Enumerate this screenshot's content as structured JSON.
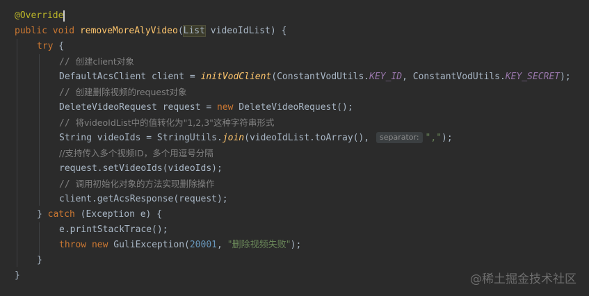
{
  "code": {
    "l1": {
      "annotation": "@Override"
    },
    "l2": {
      "kw1": "public",
      "kw2": "void",
      "method": "removeMoreAlyVideo",
      "open": "(",
      "type": "List",
      "rest": " videoIdList) {"
    },
    "l3": {
      "kw": "try",
      "rest": " {"
    },
    "l4": {
      "prefix": "// ",
      "text": "创建client对象"
    },
    "l5": {
      "a": "DefaultAcsClient client = ",
      "fn": "initVodClient",
      "b": "(ConstantVodUtils.",
      "c1": "KEY_ID",
      "c": ", ConstantVodUtils.",
      "c2": "KEY_SECRET",
      "d": ");"
    },
    "l6": {
      "prefix": "// ",
      "text": "创建删除视频的request对象"
    },
    "l7": {
      "a": "DeleteVideoRequest request = ",
      "kw": "new",
      "b": " DeleteVideoRequest();"
    },
    "l8": {
      "prefix": "// ",
      "text": "将videoIdList中的值转化为\"1,2,3\"这种字符串形式"
    },
    "l9": {
      "a": "String videoIds = StringUtils.",
      "fn": "join",
      "b": "(videoIdList.toArray(),",
      "hint": "separator:",
      "str": "\",\"",
      "d": ");"
    },
    "l10": {
      "text": "//支持传入多个视频ID，多个用逗号分隔"
    },
    "l11": {
      "code": "request.setVideoIds(videoIds);"
    },
    "l12": {
      "prefix": "// ",
      "text": "调用初始化对象的方法实现删除操作"
    },
    "l13": {
      "code": "client.getAcsResponse(request);"
    },
    "l14": {
      "a": "} ",
      "kw": "catch",
      "b": " (Exception e) {"
    },
    "l15": {
      "code": "e.printStackTrace();"
    },
    "l16": {
      "kw1": "throw",
      "kw2": "new",
      "a": " GuliException(",
      "num": "20001",
      "b": ", ",
      "str": "\"删除视频失败\"",
      "d": ");"
    },
    "l17": {
      "code": "}"
    },
    "l18": {
      "code": "}"
    }
  },
  "watermark": "@稀土掘金技术社区",
  "colors": {
    "background": "#2b2b2b",
    "keyword": "#cc7832",
    "annotation": "#bbb529",
    "method": "#ffc66d",
    "comment": "#808080",
    "string": "#6a8759",
    "number": "#6897bb",
    "constant": "#9876aa"
  }
}
